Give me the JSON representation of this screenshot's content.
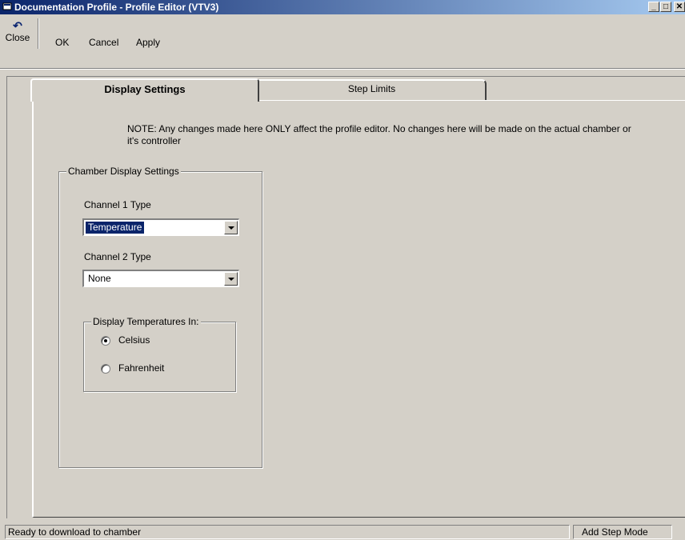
{
  "window": {
    "title": "Documentation Profile - Profile Editor (VTV3)",
    "min_glyph": "_",
    "max_glyph": "□",
    "close_glyph": "✕"
  },
  "toolbar": {
    "close_label": "Close",
    "ok_label": "OK",
    "cancel_label": "Cancel",
    "apply_label": "Apply"
  },
  "tabs": [
    {
      "label": "Display Settings",
      "active": true
    },
    {
      "label": "Step Limits",
      "active": false
    }
  ],
  "note_text": "NOTE:  Any changes made here ONLY affect the profile editor.  No changes here will be made on the actual chamber or it's controller",
  "chamber_group": {
    "label": "Chamber Display Settings",
    "channel1_label": "Channel 1 Type",
    "channel1_value": "Temperature",
    "channel2_label": "Channel 2 Type",
    "channel2_value": "None"
  },
  "temp_group": {
    "label": "Display Temperatures In:",
    "options": [
      {
        "label": "Celsius",
        "selected": true
      },
      {
        "label": "Fahrenheit",
        "selected": false
      }
    ]
  },
  "statusbar": {
    "message": "Ready to download to chamber",
    "mode": "Add Step Mode"
  },
  "icons": {
    "undo": "↶"
  }
}
